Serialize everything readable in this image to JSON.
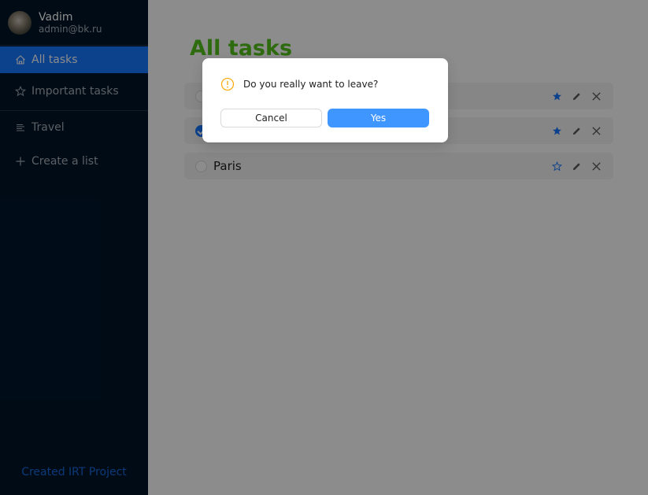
{
  "user": {
    "name": "Vadim",
    "email": "admin@bk.ru"
  },
  "sidebar": {
    "items": [
      {
        "label": "All tasks",
        "icon": "home-icon",
        "active": true
      },
      {
        "label": "Important tasks",
        "icon": "star-outline-icon",
        "active": false
      },
      {
        "label": "Travel",
        "icon": "list-icon",
        "active": false
      },
      {
        "label": "Create a list",
        "icon": "plus-icon",
        "active": false
      }
    ],
    "footer": "Created IRT Project"
  },
  "main": {
    "title": "All tasks",
    "tasks": [
      {
        "title": "",
        "done": false,
        "important": true
      },
      {
        "title": "",
        "done": true,
        "important": true
      },
      {
        "title": "Paris",
        "done": false,
        "important": false
      }
    ]
  },
  "modal": {
    "message": "Do you really want to leave?",
    "cancel_label": "Cancel",
    "confirm_label": "Yes",
    "icon": "exclamation-circle-icon"
  },
  "colors": {
    "sidebar_bg": "#001529",
    "accent": "#1677ff",
    "title": "#52c41a",
    "warning": "#faad14"
  }
}
